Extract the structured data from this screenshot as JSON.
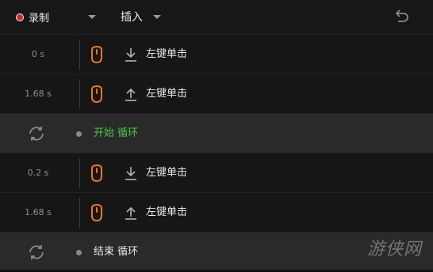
{
  "toolbar": {
    "record_label": "录制",
    "insert_label": "插入"
  },
  "rows": [
    {
      "time": "0 s",
      "action": "左键单击",
      "direction": "down"
    },
    {
      "time": "1.68 s",
      "action": "左键单击",
      "direction": "up"
    },
    {
      "loop_label": "开始 循环"
    },
    {
      "time": "0.2 s",
      "action": "左键单击",
      "direction": "down"
    },
    {
      "time": "1.68 s",
      "action": "左键单击",
      "direction": "up"
    },
    {
      "loop_label": "结束 循环"
    }
  ],
  "colors": {
    "accent_orange": "#e8762b",
    "loop_start_green": "#4cc542",
    "loop_end_text": "#e6e6e6",
    "record_red": "#d6282c"
  },
  "watermark": "游侠网"
}
